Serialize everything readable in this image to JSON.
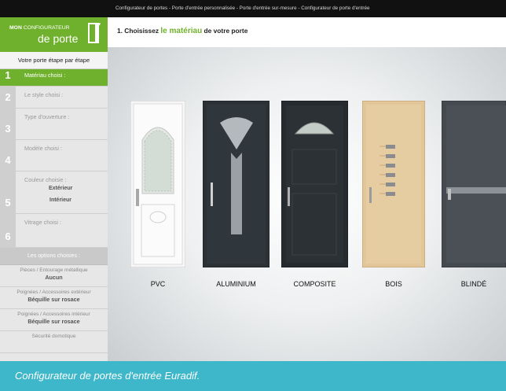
{
  "topbar": {
    "breadcrumb": "Configurateur de portes - Porte d'entrée personnalisée - Porte d'entrée sur-mesure - Configurateur de porte d'entrée"
  },
  "logo": {
    "line1_bold": "MON",
    "line1_rest": " CONFIGURATEUR",
    "line2": "de porte"
  },
  "sidebar": {
    "title": "Votre porte étape par étape",
    "steps": [
      {
        "num": "1",
        "label": "Matériau choisi :"
      },
      {
        "num": "2",
        "label": "Le style choisi :"
      },
      {
        "num": "3",
        "label": "Type d'ouverture :"
      },
      {
        "num": "4",
        "label": "Modèle choisi :"
      },
      {
        "num": "5",
        "label": "Couleur choisie :",
        "sub1": "Extérieur",
        "sub2": "Intérieur"
      },
      {
        "num": "6",
        "label": "Vitrage choisi :"
      }
    ],
    "options_header": "Les options choisies :",
    "options": [
      {
        "label": "Pièces / Entourage métallique",
        "value": "Aucun"
      },
      {
        "label": "Poignées / Accessoires extérieur",
        "value": "Béquille sur rosace"
      },
      {
        "label": "Poignées / Accessoires intérieur",
        "value": "Béquille sur rosace"
      },
      {
        "label": "Sécurité domotique",
        "value": ""
      }
    ]
  },
  "main": {
    "heading_prefix": "1. Choisissez ",
    "heading_highlight": "le matériau",
    "heading_suffix": " de votre porte"
  },
  "materials": [
    {
      "label": "PVC",
      "color": "#f4f4f4"
    },
    {
      "label": "ALUMINIUM",
      "color": "#2c3236"
    },
    {
      "label": "COMPOSITE",
      "color": "#272c31"
    },
    {
      "label": "BOIS",
      "color": "#e3c79a"
    },
    {
      "label": "BLINDÉ",
      "color": "#474c52"
    }
  ],
  "caption": "Configurateur de portes d'entrée Euradif.",
  "colors": {
    "accent": "#6fb12c",
    "caption_bg": "#3db7c9"
  }
}
